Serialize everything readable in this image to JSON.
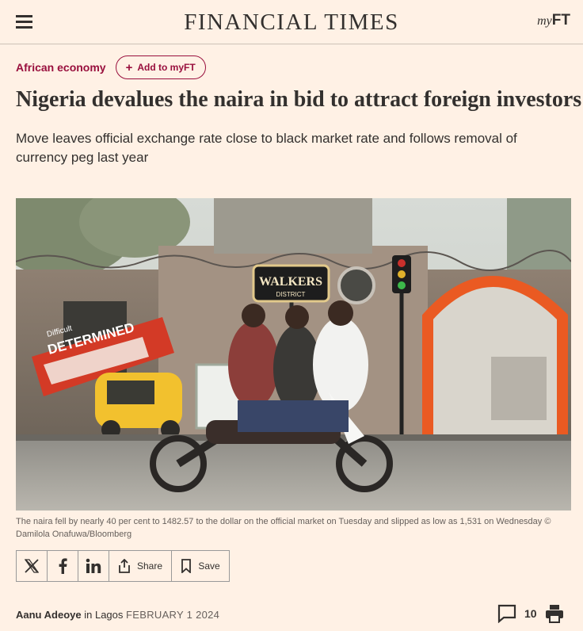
{
  "header": {
    "logo": "FINANCIAL TIMES",
    "myft_my": "my",
    "myft_ft": "FT"
  },
  "topic": {
    "label": "African economy",
    "add_label": "Add to myFT"
  },
  "article": {
    "headline": "Nigeria devalues the naira in bid to attract foreign investors",
    "standfirst": "Move leaves official exchange rate close to black market rate and follows removal of currency peg last year",
    "image_sign": "WALKERS",
    "image_sign_sub": "DISTRICT",
    "image_banner_strike": "Difficult",
    "image_banner": "DETERMINED",
    "caption": "The naira fell by nearly 40 per cent to 1482.57 to the dollar on the official market on Tuesday and slipped as low as 1,531 on Wednesday © Damilola Onafuwa/Bloomberg"
  },
  "share": {
    "share_label": "Share",
    "save_label": "Save"
  },
  "byline": {
    "author": "Aanu Adeoye",
    "in": "in",
    "location": "Lagos",
    "date": "FEBRUARY 1 2024"
  },
  "tools": {
    "comment_count": "10"
  },
  "colors": {
    "background": "#fff1e5",
    "claret": "#990f3d",
    "text": "#33302e"
  }
}
